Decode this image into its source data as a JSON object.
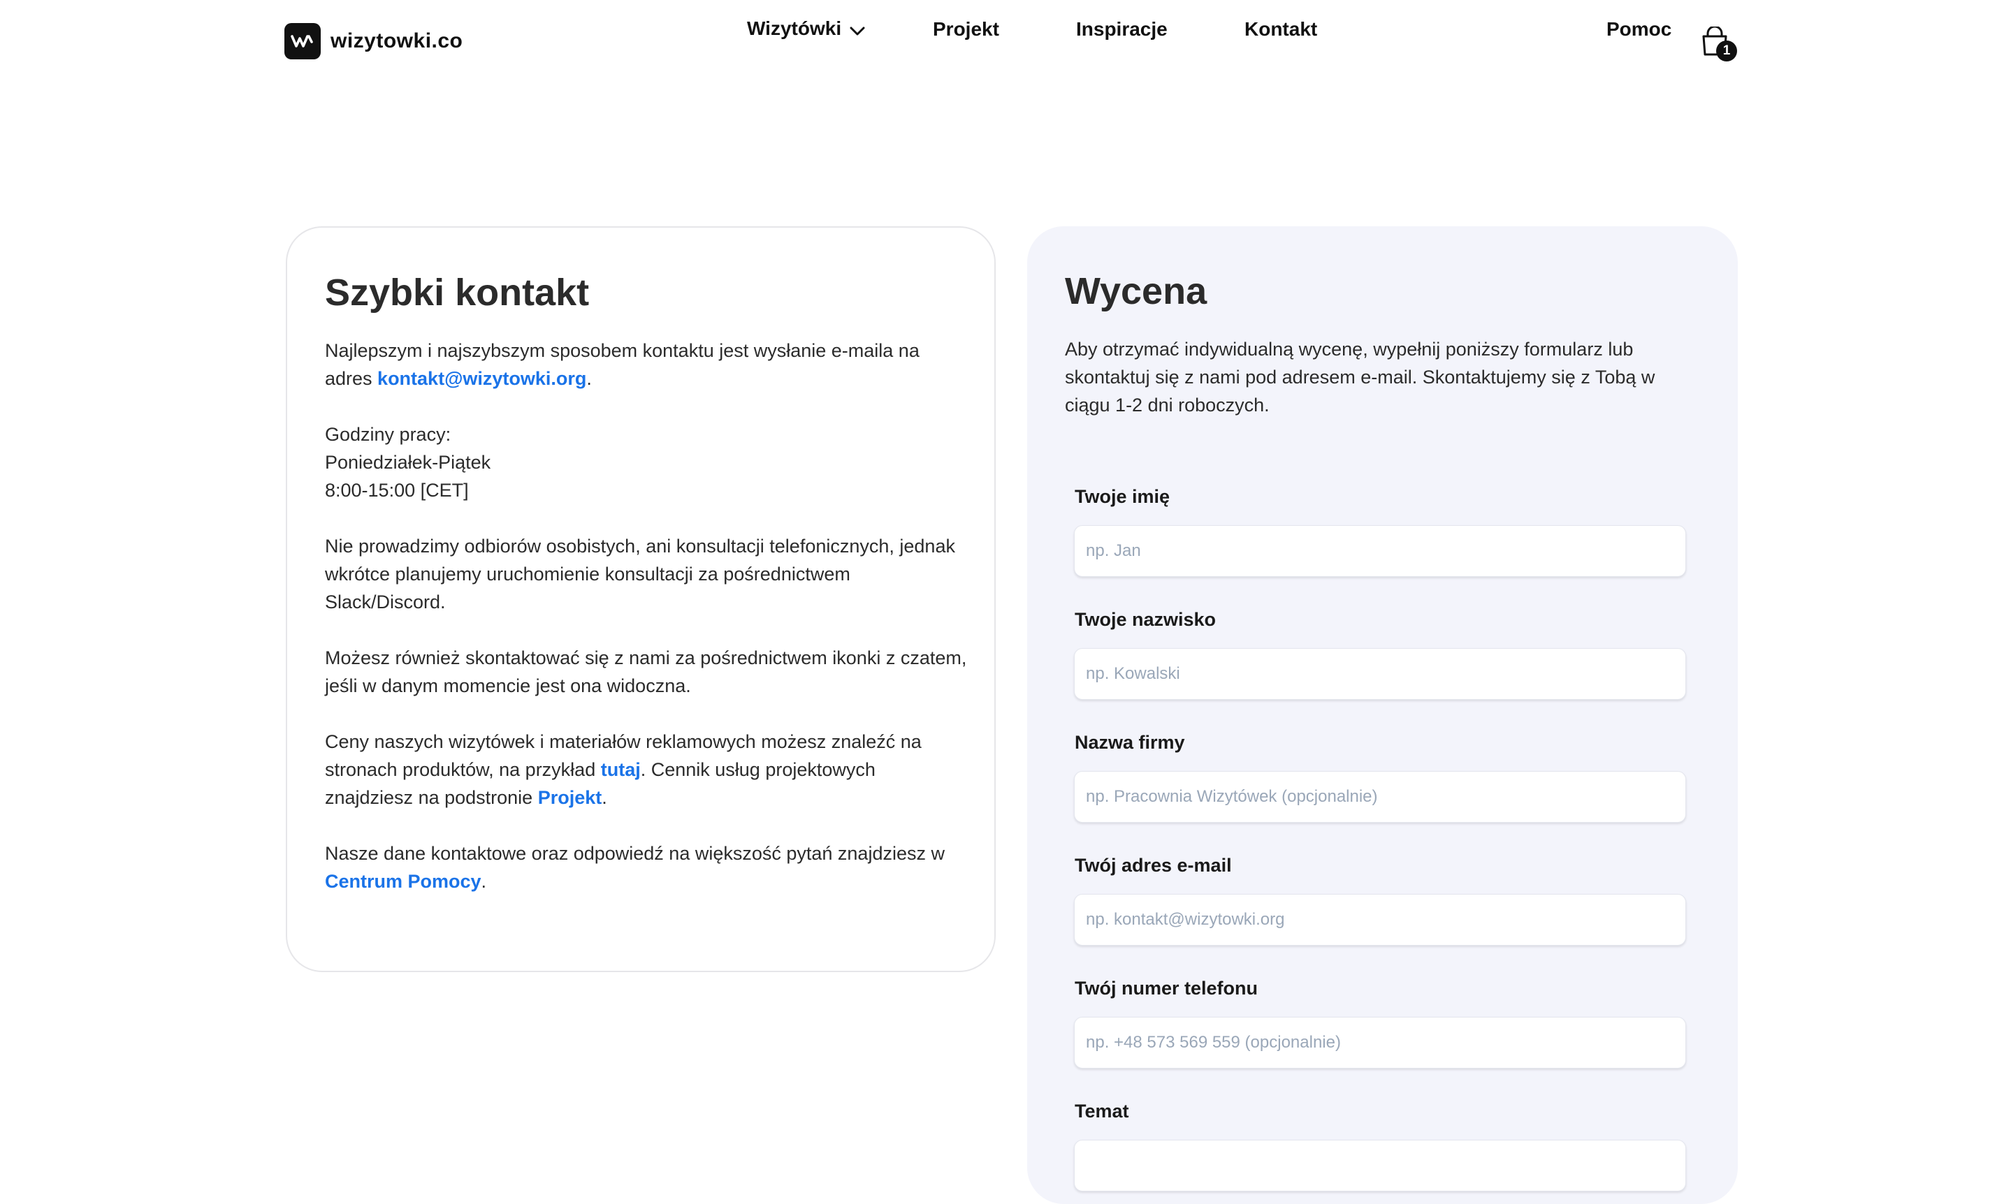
{
  "header": {
    "logo_text": "wizytowki.co",
    "nav": [
      {
        "label": "Wizytówki",
        "has_dropdown": true
      },
      {
        "label": "Projekt"
      },
      {
        "label": "Inspiracje"
      },
      {
        "label": "Kontakt"
      }
    ],
    "help_label": "Pomoc",
    "cart_count": "1"
  },
  "quick_contact": {
    "title": "Szybki kontakt",
    "p1_text": "Najlepszym i najszybszym sposobem kontaktu jest wysłanie e-maila na adres ",
    "p1_link": "kontakt@wizytowki.org",
    "p1_end": ".",
    "hours_label": "Godziny pracy:",
    "hours_days": "Poniedziałek-Piątek",
    "hours_time": "8:00-15:00 [CET]",
    "p3": "Nie prowadzimy odbiorów osobistych, ani konsultacji telefonicznych, jednak wkrótce planujemy uruchomienie konsultacji za pośrednictwem Slack/Discord.",
    "p4": "Możesz również skontaktować się z nami za pośrednictwem ikonki z czatem, jeśli w danym momencie jest ona widoczna.",
    "p5_text1": "Ceny naszych wizytówek i materiałów reklamowych możesz znaleźć na stronach produktów, na przykład ",
    "p5_link1": "tutaj",
    "p5_text2": ". Cennik usług projektowych znajdziesz na podstronie ",
    "p5_link2": "Projekt",
    "p5_end": ".",
    "p6_text": "Nasze dane kontaktowe oraz odpowiedź na większość pytań znajdziesz w ",
    "p6_link": "Centrum Pomocy",
    "p6_end": "."
  },
  "quote": {
    "title": "Wycena",
    "intro": "Aby otrzymać indywidualną wycenę, wypełnij poniższy formularz lub skontaktuj się z nami pod adresem e-mail. Skontaktujemy się z Tobą w ciągu 1-2 dni roboczych.",
    "fields": [
      {
        "label": "Twoje imię",
        "placeholder": "np. Jan",
        "value": ""
      },
      {
        "label": "Twoje nazwisko",
        "placeholder": "np. Kowalski",
        "value": ""
      },
      {
        "label": "Nazwa firmy",
        "placeholder": "np. Pracownia Wizytówek (opcjonalnie)",
        "value": ""
      },
      {
        "label": "Twój adres e-mail",
        "placeholder": "np. kontakt@wizytowki.org",
        "value": ""
      },
      {
        "label": "Twój numer telefonu",
        "placeholder": "np. +48 573 569 559 (opcjonalnie)",
        "value": ""
      },
      {
        "label": "Temat",
        "placeholder": "",
        "value": ""
      }
    ]
  },
  "colors": {
    "link": "#1a73e8",
    "quote_bg": "#f3f4fb",
    "text": "#2b2b2b"
  },
  "icons": [
    "logo-mark-icon",
    "chevron-down-icon",
    "shopping-bag-icon"
  ]
}
